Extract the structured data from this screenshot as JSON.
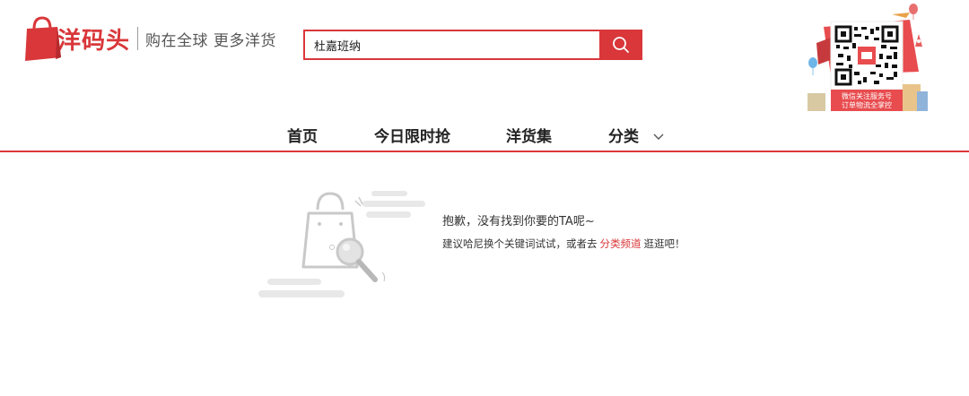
{
  "header": {
    "logo_text": "洋码头",
    "slogan": "购在全球 更多洋货",
    "search": {
      "value": "杜嘉班纳"
    },
    "qr_caption_line1": "微信关注服务号",
    "qr_caption_line2": "订单物流全掌控"
  },
  "nav": {
    "items": [
      {
        "label": "首页"
      },
      {
        "label": "今日限时抢"
      },
      {
        "label": "洋货集"
      },
      {
        "label": "分类"
      }
    ]
  },
  "empty_state": {
    "title": "抱歉，没有找到你要的TA呢~",
    "tip_before": "建议哈尼换个关键词试试，或者去",
    "tip_link": "分类频道",
    "tip_after": "逛逛吧！"
  },
  "colors": {
    "brand_red": "#d9373a",
    "illustration_gray": "#cfcfcf"
  },
  "icons": [
    "shopping-bag-logo-icon",
    "search-icon",
    "qr-code-icon",
    "chevron-down-icon",
    "empty-bag-magnifier-icon"
  ]
}
